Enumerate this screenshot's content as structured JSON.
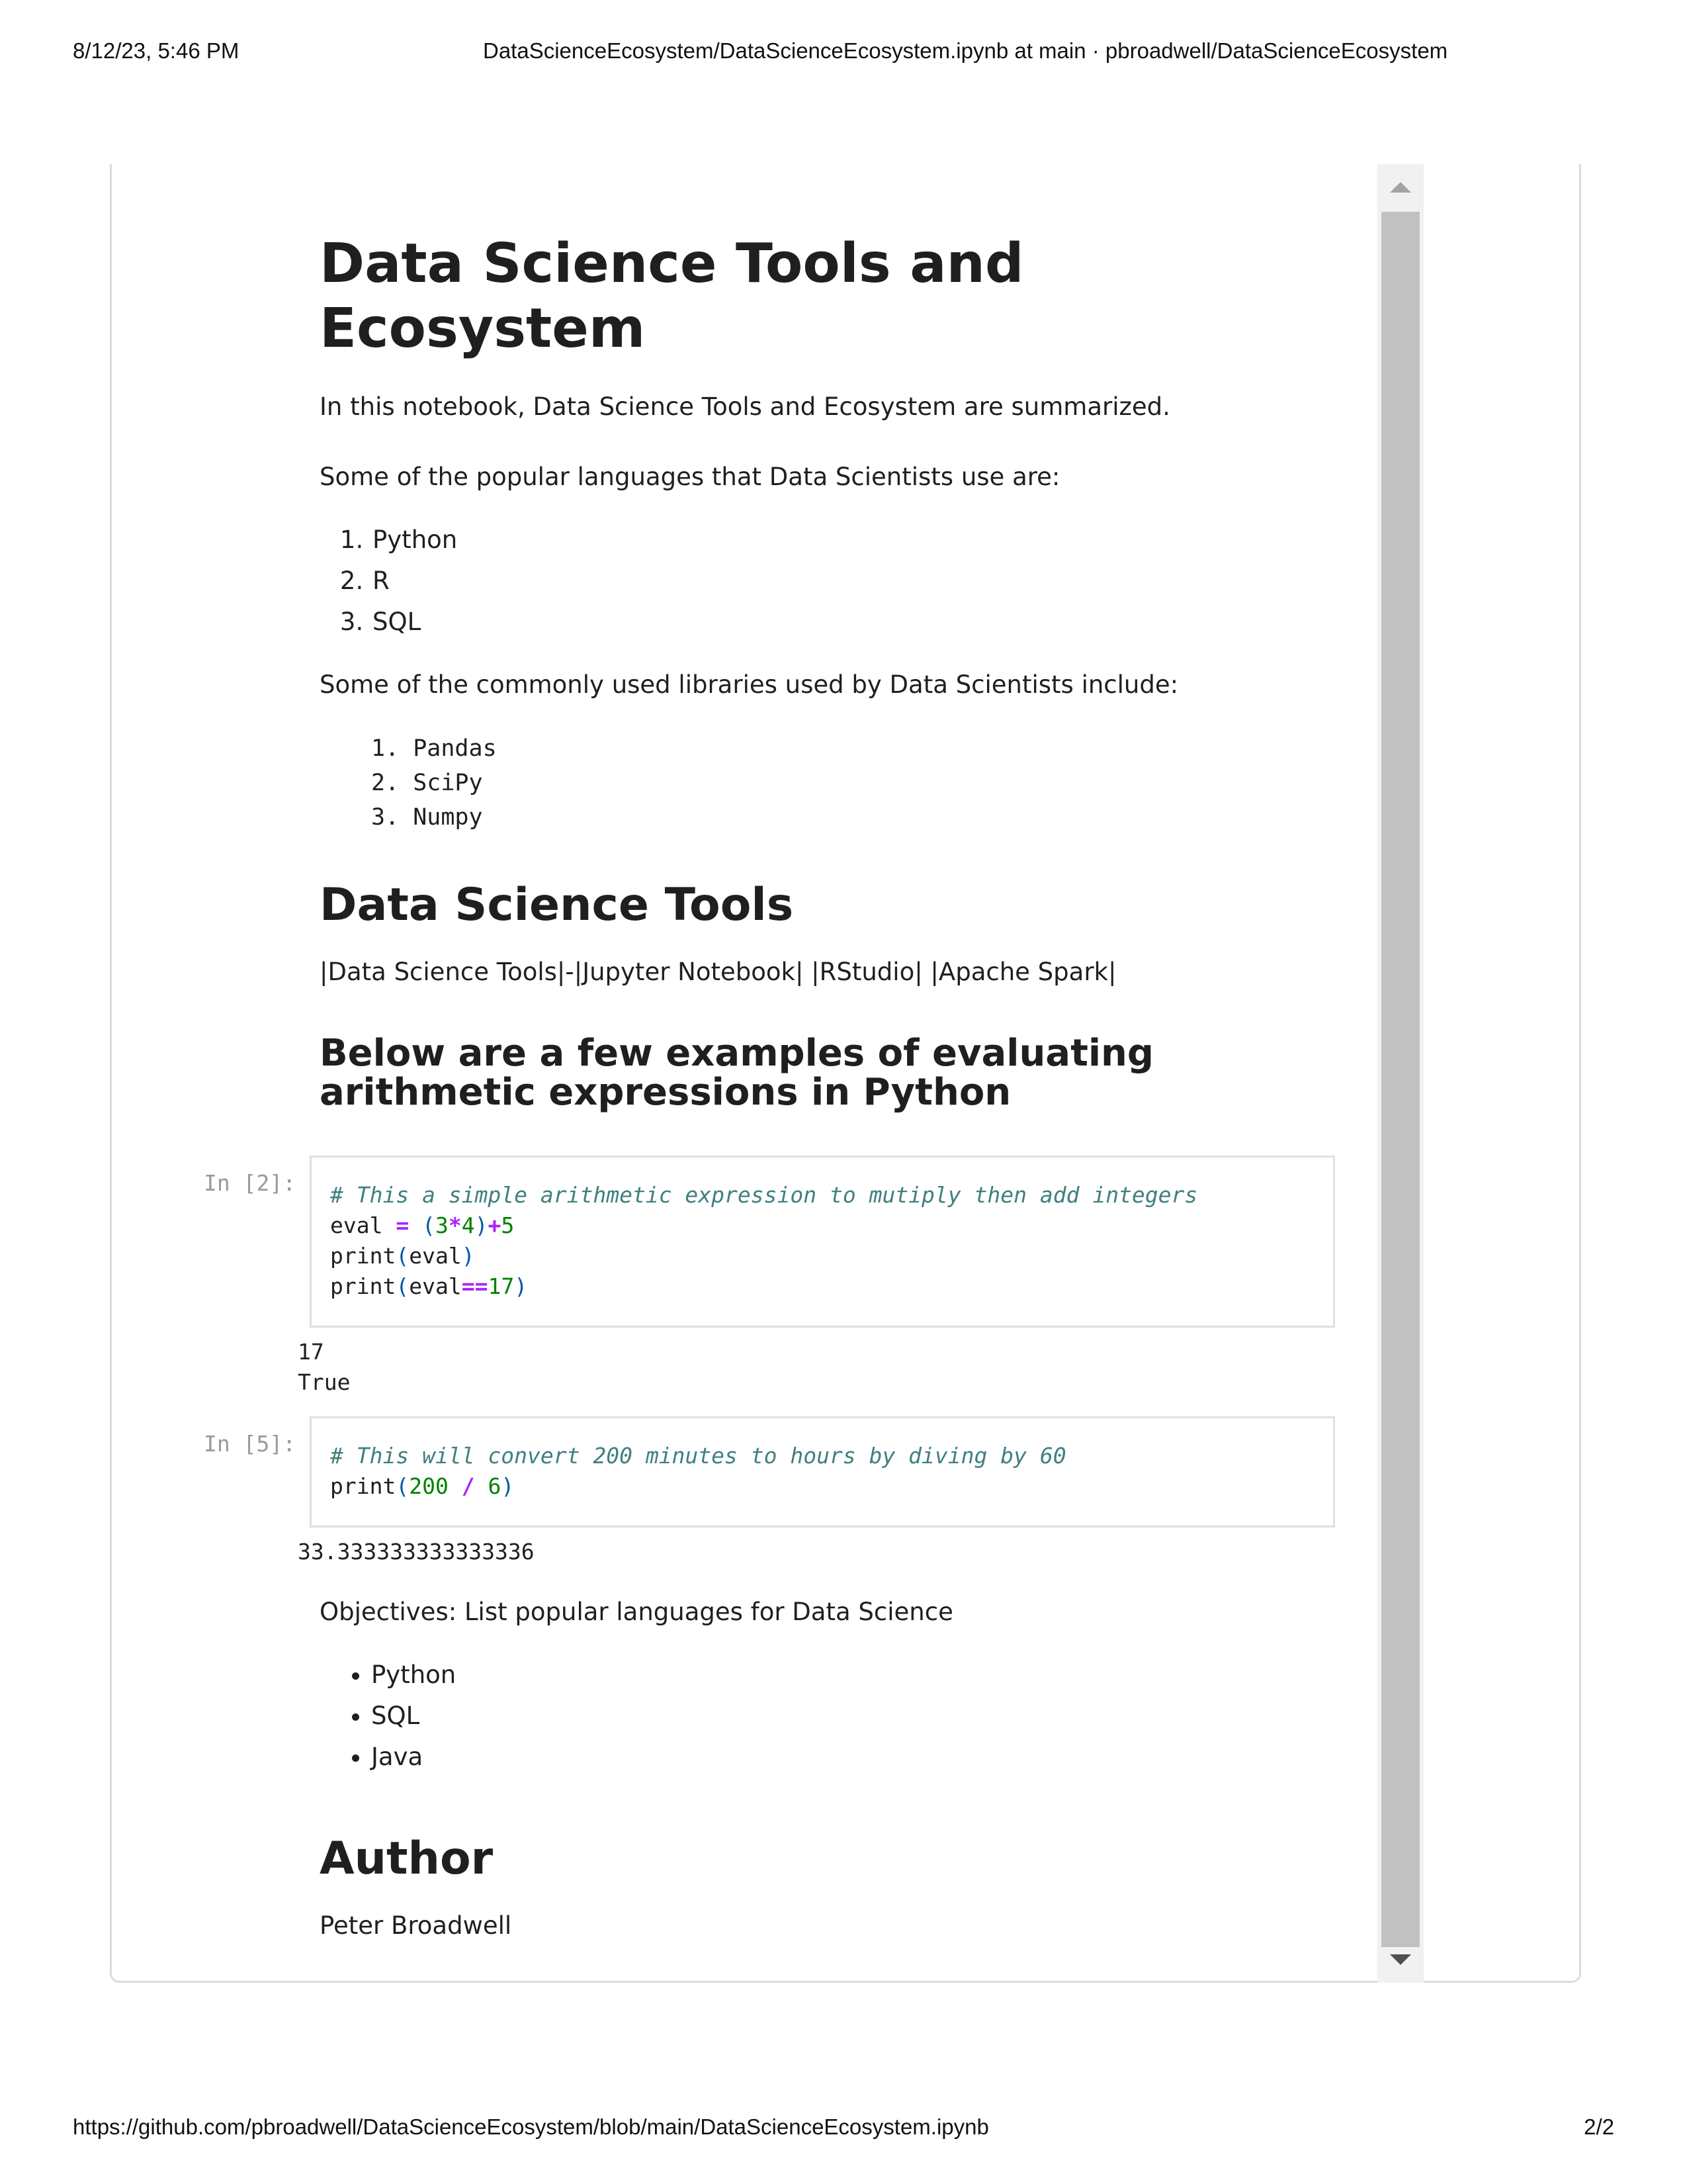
{
  "print_header": {
    "date": "8/12/23, 5:46 PM",
    "title": "DataScienceEcosystem/DataScienceEcosystem.ipynb at main · pbroadwell/DataScienceEcosystem"
  },
  "print_footer": {
    "url": "https://github.com/pbroadwell/DataScienceEcosystem/blob/main/DataScienceEcosystem.ipynb",
    "page_number": "2/2"
  },
  "notebook": {
    "title": "Data Science Tools and Ecosystem",
    "intro": "In this notebook, Data Science Tools and Ecosystem are summarized.",
    "languages_intro": "Some of the popular languages that Data Scientists use are:",
    "languages": [
      "Python",
      "R",
      "SQL"
    ],
    "libraries_intro": "Some of the commonly used libraries used by Data Scientists include:",
    "libraries": [
      "1. Pandas",
      "2. SciPy",
      "3. Numpy"
    ],
    "tools_heading": "Data Science Tools",
    "tools_table_text": "|Data Science Tools|-|Jupyter Notebook| |RStudio| |Apache Spark|",
    "arith_heading": "Below are a few examples of evaluating arithmetic expressions in Python",
    "cells": [
      {
        "prompt": "In [2]:",
        "comment": "# This a simple arithmetic expression to mutiply then add integers",
        "output": [
          "17",
          "True"
        ]
      },
      {
        "prompt": "In [5]:",
        "comment": "# This will convert 200 minutes to hours by diving by 60",
        "output": [
          "33.333333333333336"
        ]
      }
    ],
    "objectives_intro": "Objectives: List popular languages for Data Science",
    "objectives": [
      "Python",
      "SQL",
      "Java"
    ],
    "author_heading": "Author",
    "author_name": "Peter Broadwell"
  }
}
